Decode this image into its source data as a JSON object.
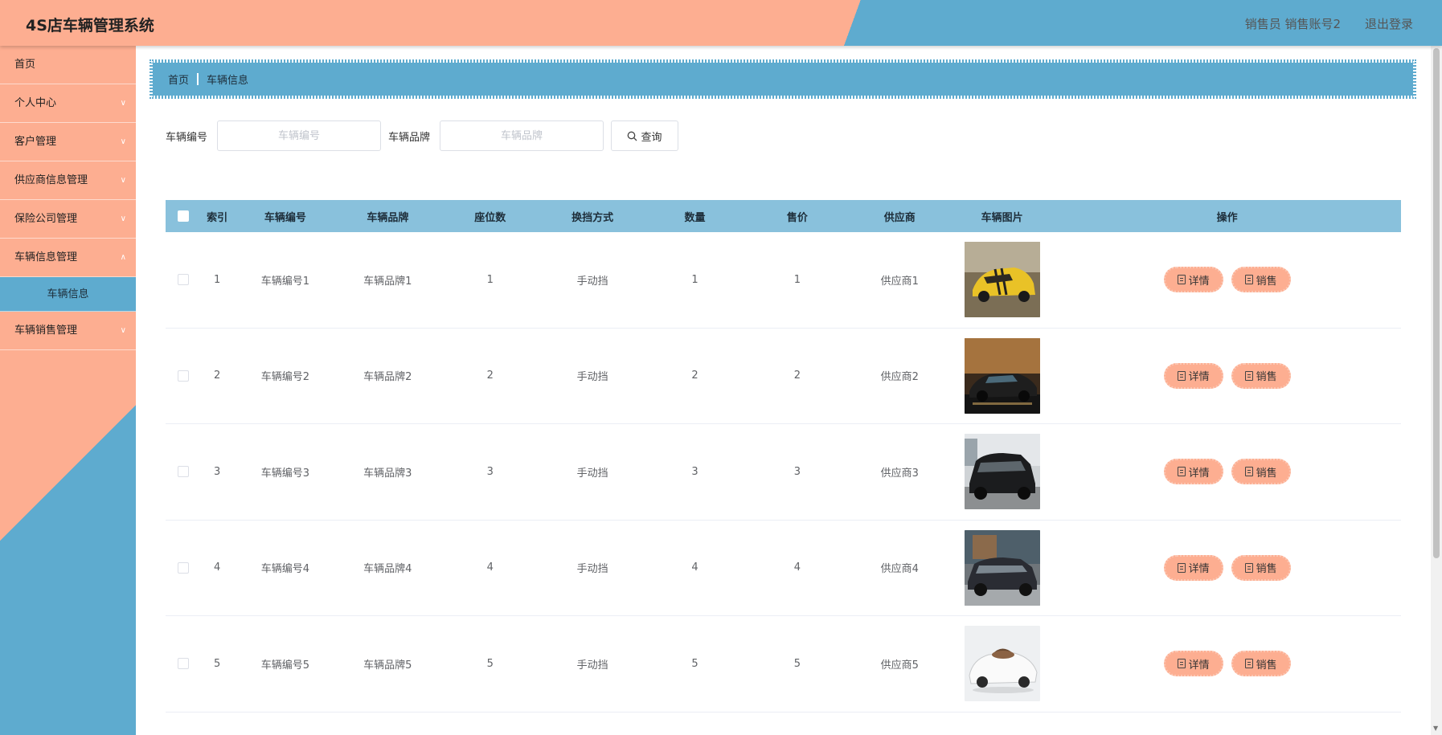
{
  "header": {
    "app_title": "4S店车辆管理系统",
    "user_info": "销售员 销售账号2",
    "logout": "退出登录"
  },
  "sidebar": {
    "items": [
      {
        "label": "首页"
      },
      {
        "label": "个人中心"
      },
      {
        "label": "客户管理"
      },
      {
        "label": "供应商信息管理"
      },
      {
        "label": "保险公司管理"
      },
      {
        "label": "车辆信息管理"
      },
      {
        "label": "车辆信息"
      },
      {
        "label": "车辆销售管理"
      }
    ]
  },
  "breadcrumb": {
    "home": "首页",
    "current": "车辆信息"
  },
  "search": {
    "vehicle_no_label": "车辆编号",
    "vehicle_no_placeholder": "车辆编号",
    "vehicle_no_value": "",
    "brand_label": "车辆品牌",
    "brand_placeholder": "车辆品牌",
    "brand_value": "",
    "query_label": "查询"
  },
  "table": {
    "headers": [
      "索引",
      "车辆编号",
      "车辆品牌",
      "座位数",
      "换挡方式",
      "数量",
      "售价",
      "供应商",
      "车辆图片",
      "操作"
    ],
    "detail_label": "详情",
    "sell_label": "销售",
    "rows": [
      {
        "idx": "1",
        "no": "车辆编号1",
        "brand": "车辆品牌1",
        "seats": "1",
        "gear": "手动挡",
        "qty": "1",
        "price": "1",
        "supplier": "供应商1"
      },
      {
        "idx": "2",
        "no": "车辆编号2",
        "brand": "车辆品牌2",
        "seats": "2",
        "gear": "手动挡",
        "qty": "2",
        "price": "2",
        "supplier": "供应商2"
      },
      {
        "idx": "3",
        "no": "车辆编号3",
        "brand": "车辆品牌3",
        "seats": "3",
        "gear": "手动挡",
        "qty": "3",
        "price": "3",
        "supplier": "供应商3"
      },
      {
        "idx": "4",
        "no": "车辆编号4",
        "brand": "车辆品牌4",
        "seats": "4",
        "gear": "手动挡",
        "qty": "4",
        "price": "4",
        "supplier": "供应商4"
      },
      {
        "idx": "5",
        "no": "车辆编号5",
        "brand": "车辆品牌5",
        "seats": "5",
        "gear": "手动挡",
        "qty": "5",
        "price": "5",
        "supplier": "供应商5"
      }
    ]
  },
  "colors": {
    "primary_blue": "#5eabcf",
    "primary_orange": "#fdae91",
    "table_header": "#89c1dc"
  }
}
